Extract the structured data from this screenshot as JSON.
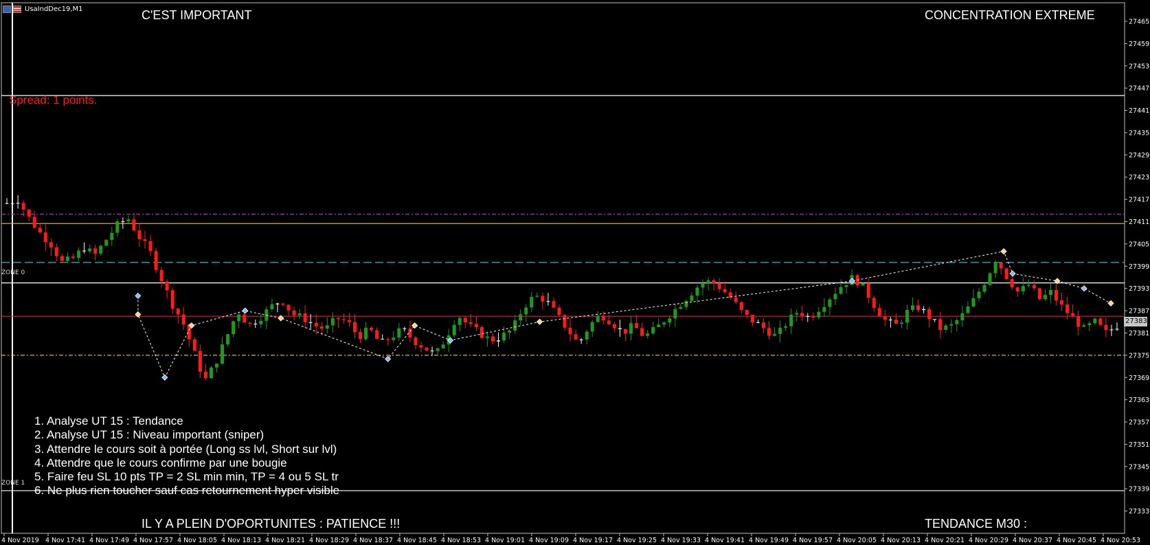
{
  "window": {
    "symbol": "UsaIndDec19,M1"
  },
  "overlay": {
    "title_left": "C'EST IMPORTANT",
    "title_right": "CONCENTRATION EXTREME",
    "bottom_left": "IL Y A PLEIN D'OPORTUNITES : PATIENCE !!!",
    "bottom_right": "TENDANCE M30 :",
    "spread": "Spread: 1 points.",
    "zone_labels": [
      "ZONE 0",
      "ZONE 1"
    ],
    "checklist": [
      "1. Analyse UT 15 : Tendance",
      "2. Analyse UT 15 : Niveau important (sniper)",
      "3. Attendre le cours soit à portée (Long ss lvl, Short sur lvl)",
      "4. Attendre que le cours confirme par une bougie",
      "5. Faire feu SL 10 pts TP = 2 SL min min, TP = 4 ou 5 SL tr",
      "6. Ne plus rien toucher sauf cas retournement hyper visible"
    ]
  },
  "colors": {
    "background": "#000000",
    "bull_candle": "#1e9a1e",
    "bear_candle": "#ff1a1a",
    "doji_candle": "#ffffff",
    "spread_text": "#ff1a1a",
    "level_purple": "#b030c0",
    "level_gold": "#e0b000",
    "level_cyan": "#20c0c8",
    "level_red": "#e02020",
    "level_yellow_dash": "#e0c000",
    "zone_line": "#ffffff",
    "grid_axis": "#c0c0c0"
  },
  "icons": [
    "flag-icon",
    "chart-window-icon"
  ],
  "chart_data": {
    "type": "candlestick",
    "timeframe": "M1",
    "symbol": "UsaIndDec19",
    "ylim": [
      27327,
      27470
    ],
    "current_price": "27383",
    "y_ticks": [
      "27465",
      "27459",
      "27453",
      "27447",
      "27441",
      "27435",
      "27429",
      "27423",
      "27417",
      "27411",
      "27405",
      "27399",
      "27393",
      "27387",
      "27381",
      "27375",
      "27369",
      "27363",
      "27357",
      "27351",
      "27345",
      "27339",
      "27333"
    ],
    "x_ticks": [
      "4 Nov 2019",
      "4 Nov 17:41",
      "4 Nov 17:49",
      "4 Nov 17:57",
      "4 Nov 18:05",
      "4 Nov 18:13",
      "4 Nov 18:21",
      "4 Nov 18:29",
      "4 Nov 18:37",
      "4 Nov 18:45",
      "4 Nov 18:53",
      "4 Nov 19:01",
      "4 Nov 19:09",
      "4 Nov 19:17",
      "4 Nov 19:25",
      "4 Nov 19:33",
      "4 Nov 19:41",
      "4 Nov 19:49",
      "4 Nov 19:57",
      "4 Nov 20:05",
      "4 Nov 20:13",
      "4 Nov 20:21",
      "4 Nov 20:29",
      "4 Nov 20:37",
      "4 Nov 20:45",
      "4 Nov 20:53"
    ],
    "candles_close_path": [
      27416,
      27417,
      27412,
      27408,
      27405,
      27400,
      27401,
      27404,
      27402,
      27406,
      27410,
      27412,
      27407,
      27403,
      27396,
      27389,
      27384,
      27376,
      27368,
      27373,
      27380,
      27387,
      27383,
      27385,
      27388,
      27390,
      27386,
      27385,
      27383,
      27382,
      27385,
      27384,
      27380,
      27382,
      27378,
      27380,
      27382,
      27379,
      27377,
      27375,
      27380,
      27386,
      27383,
      27381,
      27379,
      27380,
      27382,
      27388,
      27391,
      27390,
      27386,
      27382,
      27378,
      27383,
      27386,
      27384,
      27381,
      27383,
      27380,
      27382,
      27385,
      27388,
      27391,
      27394,
      27395,
      27393,
      27390,
      27386,
      27384,
      27382,
      27380,
      27384,
      27387,
      27385,
      27388,
      27391,
      27394,
      27396,
      27393,
      27388,
      27384,
      27383,
      27387,
      27388,
      27385,
      27382,
      27383,
      27386,
      27390,
      27395,
      27401,
      27396,
      27392,
      27394,
      27390,
      27392,
      27388,
      27385,
      27382,
      27384,
      27381,
      27383
    ],
    "levels": [
      {
        "price": 27445,
        "style": "solid",
        "color_key": "zone_line"
      },
      {
        "price": 27413,
        "style": "dash-dot",
        "color_key": "level_purple"
      },
      {
        "price": 27410.5,
        "style": "solid",
        "color_key": "level_gold"
      },
      {
        "price": 27400,
        "style": "dashed",
        "color_key": "level_cyan"
      },
      {
        "price": 27394.5,
        "style": "solid",
        "color_key": "zone_line",
        "label": "ZONE 0"
      },
      {
        "price": 27385.5,
        "style": "solid",
        "color_key": "level_red"
      },
      {
        "price": 27375,
        "style": "dash-dot",
        "color_key": "level_yellow_dash"
      },
      {
        "price": 27338.5,
        "style": "solid",
        "color_key": "zone_line",
        "label": "ZONE 1"
      }
    ],
    "zigzag_points": [
      {
        "i": 15,
        "price": 27391
      },
      {
        "i": 15,
        "price": 27386
      },
      {
        "i": 18,
        "price": 27369
      },
      {
        "i": 21,
        "price": 27383
      },
      {
        "i": 27,
        "price": 27387
      },
      {
        "i": 31,
        "price": 27385
      },
      {
        "i": 43,
        "price": 27374
      },
      {
        "i": 46,
        "price": 27383
      },
      {
        "i": 50,
        "price": 27379
      },
      {
        "i": 60,
        "price": 27384
      },
      {
        "i": 95,
        "price": 27395
      },
      {
        "i": 112,
        "price": 27403
      },
      {
        "i": 113,
        "price": 27397
      },
      {
        "i": 118,
        "price": 27395
      },
      {
        "i": 121,
        "price": 27393
      },
      {
        "i": 124,
        "price": 27389
      }
    ]
  }
}
